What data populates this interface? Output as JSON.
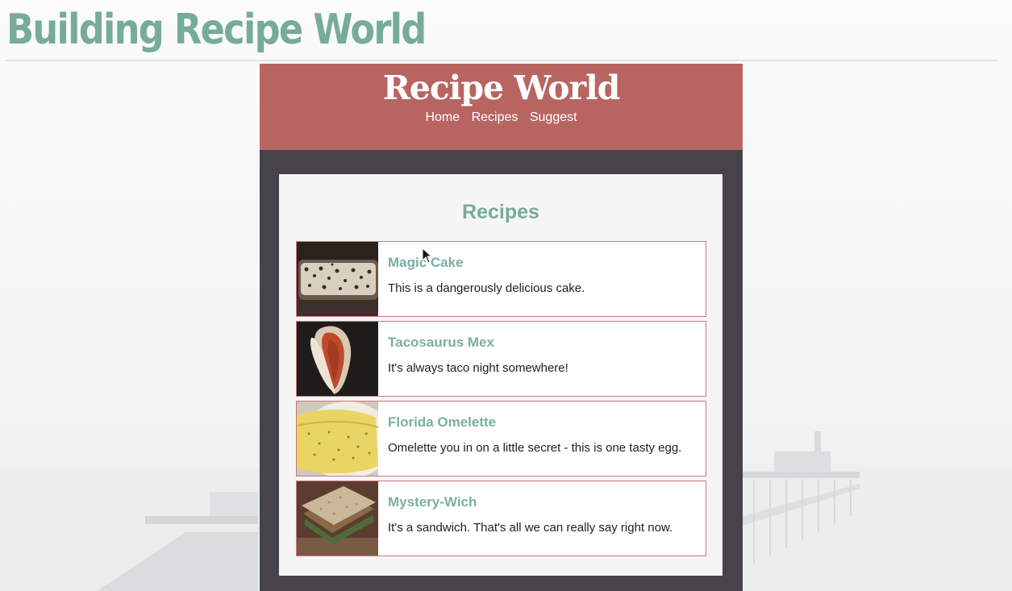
{
  "slide": {
    "title": "Building Recipe World"
  },
  "site": {
    "logo": "Recipe World",
    "nav": [
      "Home",
      "Recipes",
      "Suggest"
    ]
  },
  "section": {
    "title": "Recipes"
  },
  "recipes": [
    {
      "name": "Magic Cake",
      "description": "This is a dangerously delicious cake."
    },
    {
      "name": "Tacosaurus Mex",
      "description": "It's always taco night somewhere!"
    },
    {
      "name": "Florida Omelette",
      "description": "Omelette you in on a little secret - this is one tasty egg."
    },
    {
      "name": "Mystery-Wich",
      "description": "It's a sandwich. That's all we can really say right now."
    }
  ],
  "colors": {
    "accent_green": "#76ab9a",
    "header_red": "#b86562",
    "frame_dark": "#464349",
    "item_border": "#c97a80"
  },
  "icons": {
    "cursor": "arrow-cursor-icon"
  }
}
